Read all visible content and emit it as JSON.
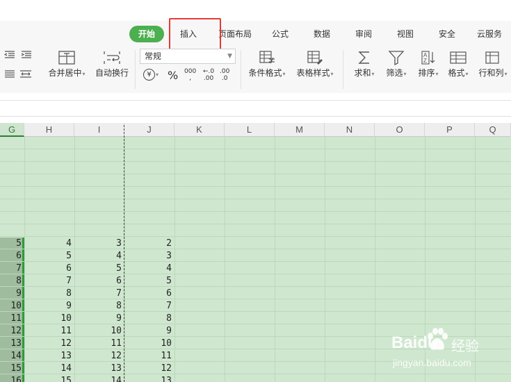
{
  "ribbon": {
    "tabs": [
      {
        "label": "开始",
        "active": true
      },
      {
        "label": "插入"
      },
      {
        "label": "页面布局"
      },
      {
        "label": "公式"
      },
      {
        "label": "数据"
      },
      {
        "label": "审阅"
      },
      {
        "label": "视图"
      },
      {
        "label": "安全"
      },
      {
        "label": "云服务"
      }
    ],
    "tools": {
      "merge": "合并居中",
      "wrap": "自动换行",
      "number_format": "常规",
      "currency_symbol": "¥",
      "percent_symbol": "%",
      "thousands_symbol": "000",
      "inc_decimal": ".00",
      "dec_decimal": ".0",
      "conditional": "条件格式",
      "table_style": "表格样式",
      "sum": "求和",
      "filter": "筛选",
      "sort": "排序",
      "format": "格式",
      "rowcol": "行和列"
    },
    "highlighted_tab": "插入"
  },
  "columns": [
    {
      "label": "G",
      "selected": true
    },
    {
      "label": "H"
    },
    {
      "label": "I"
    },
    {
      "label": "J"
    },
    {
      "label": "K"
    },
    {
      "label": "L"
    },
    {
      "label": "M"
    },
    {
      "label": "N"
    },
    {
      "label": "O"
    },
    {
      "label": "P"
    },
    {
      "label": "Q"
    }
  ],
  "rows": [
    {
      "g": "5",
      "h": "4",
      "i": "3",
      "j": "2"
    },
    {
      "g": "6",
      "h": "5",
      "i": "4",
      "j": "3"
    },
    {
      "g": "7",
      "h": "6",
      "i": "5",
      "j": "4"
    },
    {
      "g": "8",
      "h": "7",
      "i": "6",
      "j": "5"
    },
    {
      "g": "9",
      "h": "8",
      "i": "7",
      "j": "6"
    },
    {
      "g": "10",
      "h": "9",
      "i": "8",
      "j": "7"
    },
    {
      "g": "11",
      "h": "10",
      "i": "9",
      "j": "8"
    },
    {
      "g": "12",
      "h": "11",
      "i": "10",
      "j": "9"
    },
    {
      "g": "13",
      "h": "12",
      "i": "11",
      "j": "10"
    },
    {
      "g": "14",
      "h": "13",
      "i": "12",
      "j": "11"
    },
    {
      "g": "15",
      "h": "14",
      "i": "13",
      "j": "12"
    },
    {
      "g": "16",
      "h": "15",
      "i": "14",
      "j": "13"
    }
  ],
  "watermark": {
    "brand": "Baidu",
    "brand_cn": "经验",
    "url": "jingyan.baidu.com"
  },
  "colors": {
    "accent": "#4caf50",
    "highlight": "#e53935",
    "sheet_bg": "#cfe7cf"
  }
}
